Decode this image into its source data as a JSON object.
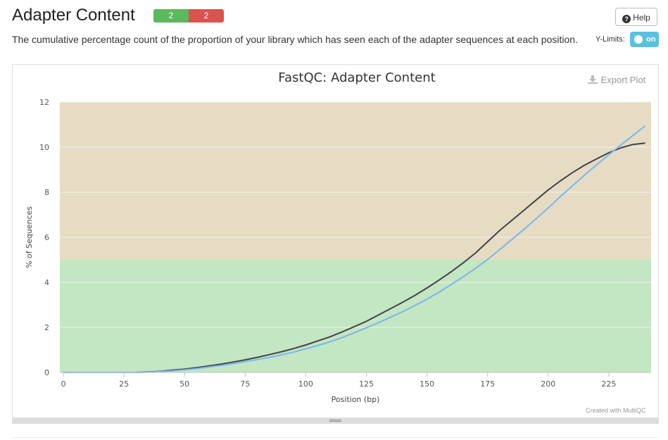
{
  "header": {
    "title": "Adapter Content",
    "badge_pass": "2",
    "badge_fail": "2",
    "help_label": "Help",
    "description": "The cumulative percentage count of the proportion of your library which has seen each of the adapter sequences at each position.",
    "ylimits_label": "Y-Limits:",
    "toggle_label": "on"
  },
  "toolbar": {
    "export_label": "Export Plot"
  },
  "footer": {
    "created_with": "Created with MultiQC"
  },
  "colors": {
    "warn_band": "#e6dcc3",
    "pass_band": "#c3e6c3",
    "series_dark": "#434348",
    "series_blue": "#7cb5ec"
  },
  "chart_data": {
    "type": "line",
    "title": "FastQC: Adapter Content",
    "xlabel": "Position (bp)",
    "ylabel": "% of Sequences",
    "xlim": [
      0,
      240
    ],
    "ylim": [
      0,
      12
    ],
    "x_ticks": [
      0,
      25,
      50,
      75,
      100,
      125,
      150,
      175,
      200,
      225
    ],
    "y_ticks": [
      0,
      2,
      4,
      6,
      8,
      10,
      12
    ],
    "bands": [
      {
        "from": 0,
        "to": 5,
        "status": "pass"
      },
      {
        "from": 5,
        "to": 12,
        "status": "warn"
      }
    ],
    "series": [
      {
        "color": "#434348",
        "x": [
          0,
          30,
          35,
          40,
          45,
          50,
          55,
          60,
          65,
          70,
          75,
          80,
          85,
          90,
          95,
          100,
          105,
          110,
          115,
          120,
          125,
          130,
          135,
          140,
          145,
          150,
          155,
          160,
          165,
          170,
          175,
          180,
          185,
          190,
          195,
          200,
          205,
          210,
          215,
          220,
          225,
          230,
          235,
          240
        ],
        "y": [
          0,
          0,
          0.02,
          0.05,
          0.1,
          0.15,
          0.21,
          0.29,
          0.37,
          0.46,
          0.56,
          0.67,
          0.79,
          0.92,
          1.06,
          1.22,
          1.4,
          1.58,
          1.8,
          2.03,
          2.27,
          2.55,
          2.83,
          3.12,
          3.42,
          3.75,
          4.1,
          4.47,
          4.87,
          5.3,
          5.8,
          6.3,
          6.75,
          7.2,
          7.65,
          8.1,
          8.5,
          8.87,
          9.2,
          9.48,
          9.75,
          9.97,
          10.12,
          10.18
        ]
      },
      {
        "color": "#7cb5ec",
        "x": [
          0,
          30,
          35,
          40,
          45,
          50,
          55,
          60,
          65,
          70,
          75,
          80,
          85,
          90,
          95,
          100,
          105,
          110,
          115,
          120,
          125,
          130,
          135,
          140,
          145,
          150,
          155,
          160,
          165,
          170,
          175,
          180,
          185,
          190,
          195,
          200,
          205,
          210,
          215,
          220,
          225,
          230,
          235,
          240
        ],
        "y": [
          0,
          0,
          0.01,
          0.04,
          0.07,
          0.12,
          0.17,
          0.24,
          0.31,
          0.39,
          0.48,
          0.57,
          0.67,
          0.78,
          0.9,
          1.05,
          1.2,
          1.36,
          1.55,
          1.76,
          1.98,
          2.21,
          2.45,
          2.7,
          2.97,
          3.25,
          3.56,
          3.9,
          4.25,
          4.62,
          5.02,
          5.45,
          5.9,
          6.35,
          6.82,
          7.3,
          7.8,
          8.28,
          8.76,
          9.22,
          9.66,
          10.1,
          10.52,
          10.95
        ]
      }
    ]
  }
}
